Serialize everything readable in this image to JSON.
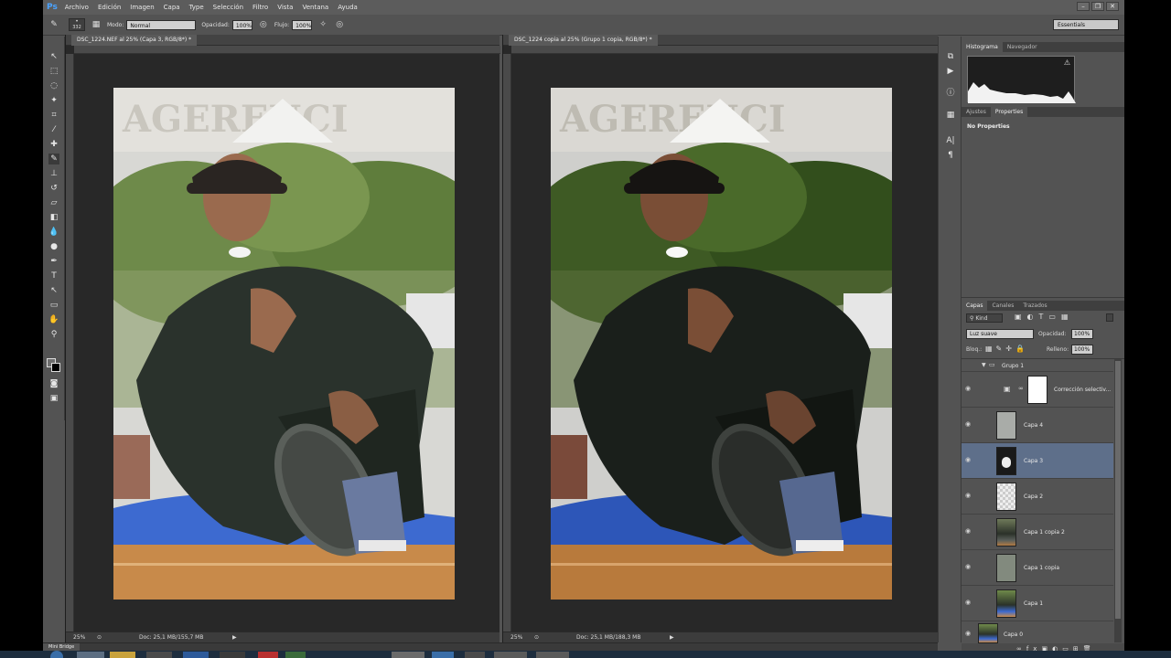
{
  "menubar": {
    "logo": "Ps",
    "items": [
      "Archivo",
      "Edición",
      "Imagen",
      "Capa",
      "Type",
      "Selección",
      "Filtro",
      "Vista",
      "Ventana",
      "Ayuda"
    ],
    "controls": [
      "–",
      "❐",
      "✕"
    ]
  },
  "options": {
    "brush_size": "332",
    "mode_label": "Modo:",
    "mode_value": "Normal",
    "opacity_label": "Opacidad:",
    "opacity_value": "100%",
    "flow_label": "Flujo:",
    "flow_value": "100%",
    "workspace": "Essentials"
  },
  "documents": [
    {
      "tab": "DSC_1224.NEF al 25% (Capa 3, RGB/8*) *",
      "zoom": "25%",
      "doc_info": "Doc: 25,1 MB/155,7 MB"
    },
    {
      "tab": "DSC_1224 copia al 25% (Grupo 1 copia, RGB/8*) *",
      "zoom": "25%",
      "doc_info": "Doc: 25,1 MB/188,3 MB"
    }
  ],
  "mini_bridge": "Mini Bridge",
  "panels": {
    "top_tabs": [
      "Histograma",
      "Navegador"
    ],
    "mid_tabs": [
      "Ajustes",
      "Properties"
    ],
    "properties_text": "No Properties",
    "layers_tabs": [
      "Capas",
      "Canales",
      "Trazados"
    ],
    "kind_label": "Kind",
    "blend_mode": "Luz suave",
    "opacity_label": "Opacidad:",
    "opacity_value": "100%",
    "lock_label": "Bloq.:",
    "fill_label": "Relleno:",
    "fill_value": "100%",
    "group_name": "Grupo 1",
    "layers": [
      {
        "name": "Corrección selectiv...",
        "thumb": "white"
      },
      {
        "name": "Capa 4",
        "thumb": "gray"
      },
      {
        "name": "Capa 3",
        "thumb": "dark",
        "selected": true
      },
      {
        "name": "Capa 2",
        "thumb": "checker"
      },
      {
        "name": "Capa 1 copia 2",
        "thumb": "photo"
      },
      {
        "name": "Capa 1 copia",
        "thumb": "graygreen"
      },
      {
        "name": "Capa 1",
        "thumb": "photo"
      },
      {
        "name": "Capa 0",
        "thumb": "photo"
      }
    ]
  }
}
